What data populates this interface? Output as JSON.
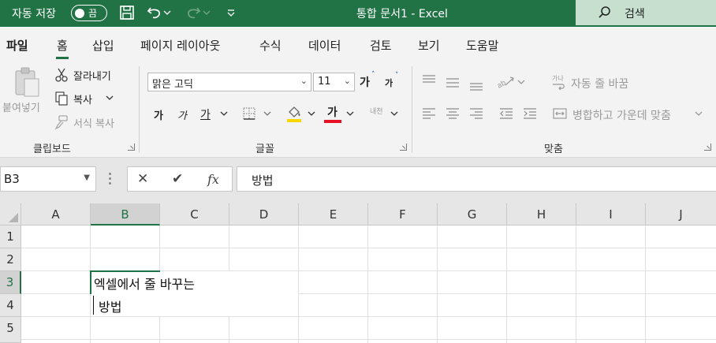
{
  "titlebar": {
    "autosave_label": "자동 저장",
    "autosave_state": "끔",
    "title": "통합 문서1  -  Excel",
    "search_label": "검색"
  },
  "tabs": [
    {
      "label": "파일",
      "active": false
    },
    {
      "label": "홈",
      "active": true
    },
    {
      "label": "삽입",
      "active": false
    },
    {
      "label": "페이지 레이아웃",
      "active": false
    },
    {
      "label": "수식",
      "active": false
    },
    {
      "label": "데이터",
      "active": false
    },
    {
      "label": "검토",
      "active": false
    },
    {
      "label": "보기",
      "active": false
    },
    {
      "label": "도움말",
      "active": false
    }
  ],
  "clipboard": {
    "paste_label": "붙여넣기",
    "cut_label": "잘라내기",
    "copy_label": "복사",
    "format_painter_label": "서식 복사",
    "group_label": "클립보드"
  },
  "font": {
    "font_name": "맑은 고딕",
    "font_size": "11",
    "grow_label": "가",
    "shrink_label": "가",
    "bold_label": "가",
    "italic_label": "가",
    "underline_label": "가",
    "font_color_label": "가",
    "phonetic_label": "내천",
    "group_label": "글꼴",
    "font_color": "#e81123",
    "fill_color": "#ffd700"
  },
  "alignment": {
    "wrap_text_label": "자동 줄 바꿈",
    "merge_label": "병합하고 가운데 맞춤",
    "group_label": "맞춤"
  },
  "formula_bar": {
    "name_box": "B3",
    "fx_label": "fx",
    "content": "방법"
  },
  "grid": {
    "columns": [
      "A",
      "B",
      "C",
      "D",
      "E",
      "F",
      "G",
      "H",
      "I",
      "J"
    ],
    "rows": [
      "1",
      "2",
      "3",
      "4",
      "5"
    ],
    "selected_column": "B",
    "selected_row": "3",
    "cell_b3_line1": "엑셀에서 줄 바꾸는",
    "cell_b3_line2": "방법"
  },
  "colors": {
    "accent": "#217346",
    "search_bg": "#c6dfce",
    "ribbon_bg": "#f3f3f3"
  }
}
